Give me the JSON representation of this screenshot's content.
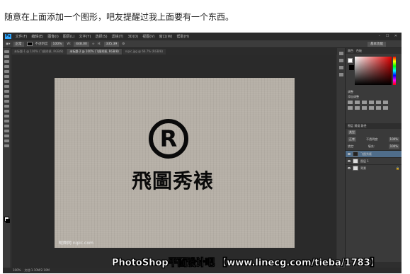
{
  "caption": "随意在上面添加一个图形，吧友提醒过我上面要有一个东西。",
  "app": {
    "logo": "Ps",
    "menus": [
      "文件(F)",
      "编辑(E)",
      "图像(I)",
      "图层(L)",
      "文字(Y)",
      "选择(S)",
      "滤镜(T)",
      "3D(D)",
      "视图(V)",
      "窗口(W)",
      "帮助(H)"
    ],
    "window_controls": "– ☐ ✕"
  },
  "options_bar": {
    "mode_label": "正常",
    "opacity_label": "不透明度",
    "opacity_value": "100%",
    "w_value": "448.00",
    "h_value": "335.39",
    "preset": "基本功能"
  },
  "tabs": [
    {
      "label": "未标题-1 @ 100% (飞图秀裱, RGB/8)",
      "active": false
    },
    {
      "label": "未标题-2 @ 100% (飞图秀裱, RGB/8)",
      "active": true
    },
    {
      "label": "nipic.jpg @ 66.7% (RGB/8)",
      "active": false
    }
  ],
  "document": {
    "logo_text": "飛圖秀裱",
    "watermark": "昵图网 nipic.com"
  },
  "status_bar": {
    "zoom": "100%",
    "doc_info": "文档:1.10M/2.10M"
  },
  "panels": {
    "tabs": [
      "颜色",
      "色板"
    ],
    "adjustments_label": "调整",
    "adjustments_subtitle": "添加调整",
    "layers_tabs": "图层 通道 路径",
    "kind": "类型",
    "blend": "正常",
    "opacity_label": "不透明度:",
    "opacity": "100%",
    "lock_label": "锁定:",
    "fill_label": "填充:",
    "fill": "100%",
    "layers": [
      {
        "name": "飞图秀裱",
        "selected": true,
        "dark": true
      },
      {
        "name": "图层 1",
        "selected": false,
        "dark": false
      },
      {
        "name": "背景",
        "selected": false,
        "dark": false
      }
    ]
  },
  "banner": "PhotoShop平面设计吧 【www.linecg.com/tieba/1783】",
  "colors": {
    "accent": "#31a8ff",
    "selected_layer": "#4f6d8a"
  }
}
